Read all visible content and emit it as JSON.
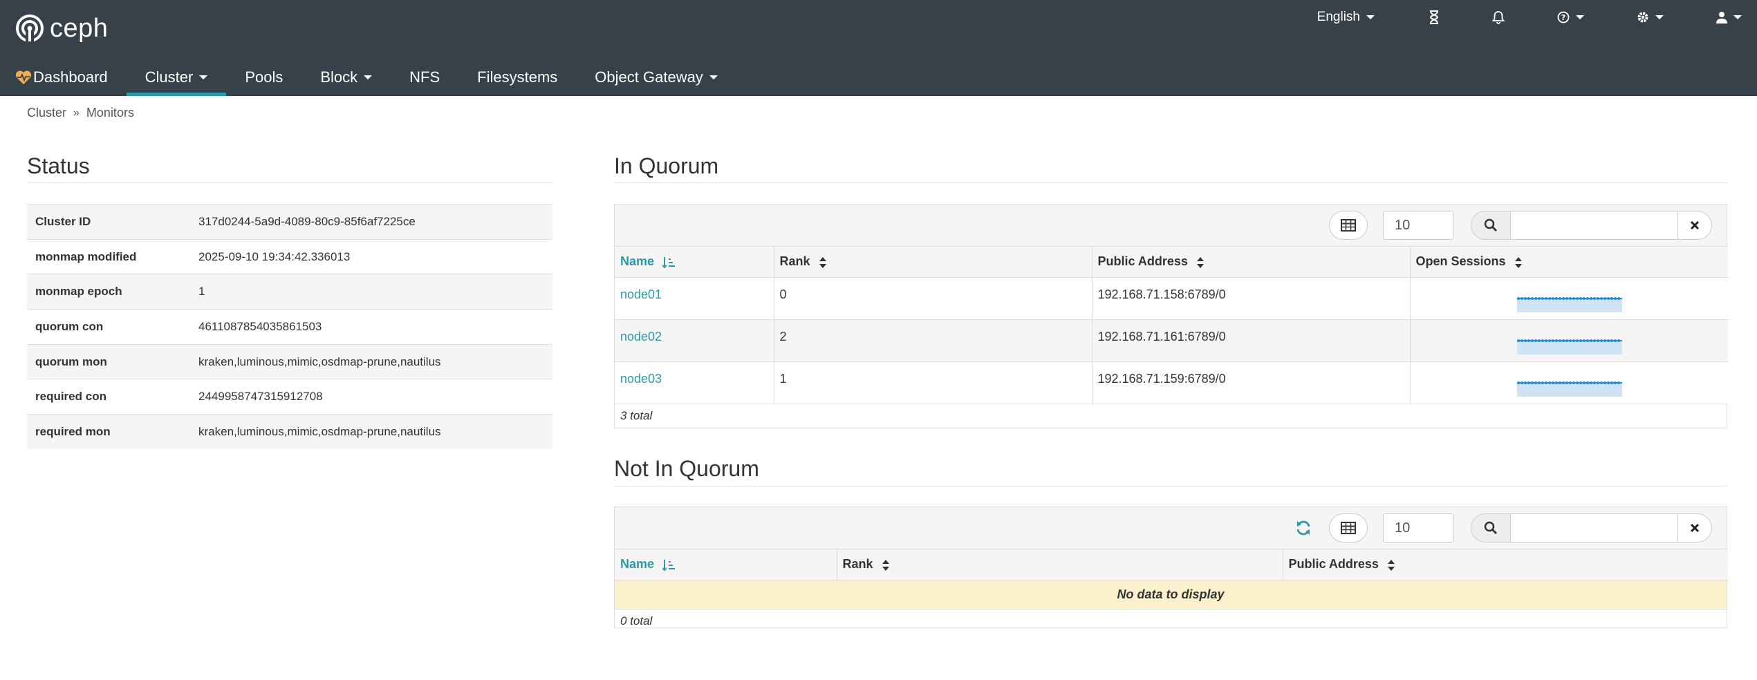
{
  "header": {
    "logo_text": "ceph",
    "language": "English",
    "icons": [
      "hourglass-icon",
      "bell-icon",
      "help-icon",
      "gear-icon",
      "user-icon"
    ]
  },
  "nav": {
    "items": [
      {
        "label": "Dashboard",
        "icon": "heart-pulse-icon",
        "dropdown": false,
        "active": false
      },
      {
        "label": "Cluster",
        "dropdown": true,
        "active": true
      },
      {
        "label": "Pools",
        "dropdown": false,
        "active": false
      },
      {
        "label": "Block",
        "dropdown": true,
        "active": false
      },
      {
        "label": "NFS",
        "dropdown": false,
        "active": false
      },
      {
        "label": "Filesystems",
        "dropdown": false,
        "active": false
      },
      {
        "label": "Object Gateway",
        "dropdown": true,
        "active": false
      }
    ]
  },
  "breadcrumb": {
    "parent": "Cluster",
    "current": "Monitors"
  },
  "status": {
    "title": "Status",
    "rows": [
      {
        "key": "Cluster ID",
        "value": "317d0244-5a9d-4089-80c9-85f6af7225ce"
      },
      {
        "key": "monmap modified",
        "value": "2025-09-10 19:34:42.336013"
      },
      {
        "key": "monmap epoch",
        "value": "1"
      },
      {
        "key": "quorum con",
        "value": "4611087854035861503"
      },
      {
        "key": "quorum mon",
        "value": "kraken,luminous,mimic,osdmap-prune,nautilus"
      },
      {
        "key": "required con",
        "value": "2449958747315912708"
      },
      {
        "key": "required mon",
        "value": "kraken,luminous,mimic,osdmap-prune,nautilus"
      }
    ]
  },
  "in_quorum": {
    "title": "In Quorum",
    "page_size": "10",
    "search_value": "",
    "columns": [
      "Name",
      "Rank",
      "Public Address",
      "Open Sessions"
    ],
    "rows": [
      {
        "name": "node01",
        "rank": "0",
        "address": "192.168.71.158:6789/0"
      },
      {
        "name": "node02",
        "rank": "2",
        "address": "192.168.71.161:6789/0"
      },
      {
        "name": "node03",
        "rank": "1",
        "address": "192.168.71.159:6789/0"
      }
    ],
    "total": "3 total"
  },
  "not_in_quorum": {
    "title": "Not In Quorum",
    "page_size": "10",
    "search_value": "",
    "columns": [
      "Name",
      "Rank",
      "Public Address"
    ],
    "empty_message": "No data to display",
    "total": "0 total"
  },
  "colors": {
    "header_bg": "#374149",
    "accent": "#2b99a8",
    "sparkline": "#1f8ad8",
    "empty_row": "#fcf1cd"
  }
}
